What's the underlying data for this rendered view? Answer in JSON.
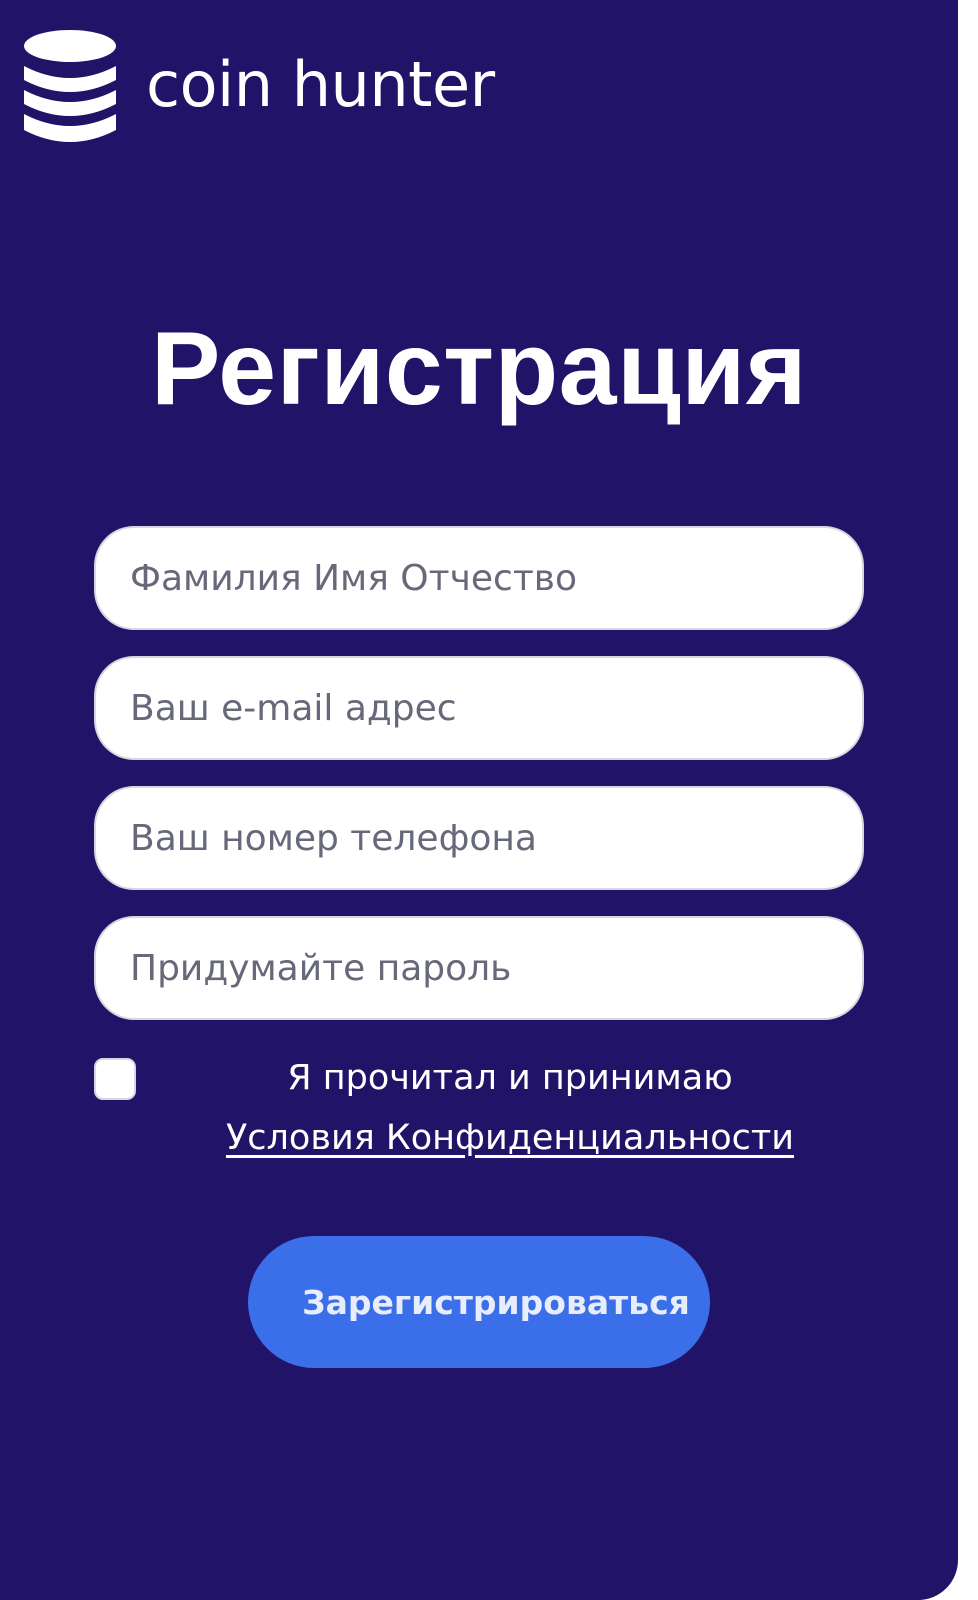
{
  "brand": {
    "name": "coin hunter",
    "icon": "coin-stack-icon"
  },
  "form": {
    "title": "Регистрация",
    "fields": {
      "full_name": {
        "value": "",
        "placeholder": "Фамилия Имя Отчество"
      },
      "email": {
        "value": "",
        "placeholder": "Ваш e-mail адрес"
      },
      "phone": {
        "value": "",
        "placeholder": "Ваш номер телефона"
      },
      "password": {
        "value": "",
        "placeholder": "Придумайте пароль"
      }
    },
    "agreement": {
      "checked": false,
      "text": "Я прочитал и принимаю",
      "link_label": "Условия Конфиденциальности"
    },
    "submit_label": "Зарегистрироваться"
  },
  "colors": {
    "background": "#211368",
    "button": "#3b6fe9",
    "field": "#ffffff",
    "text": "#ffffff"
  }
}
